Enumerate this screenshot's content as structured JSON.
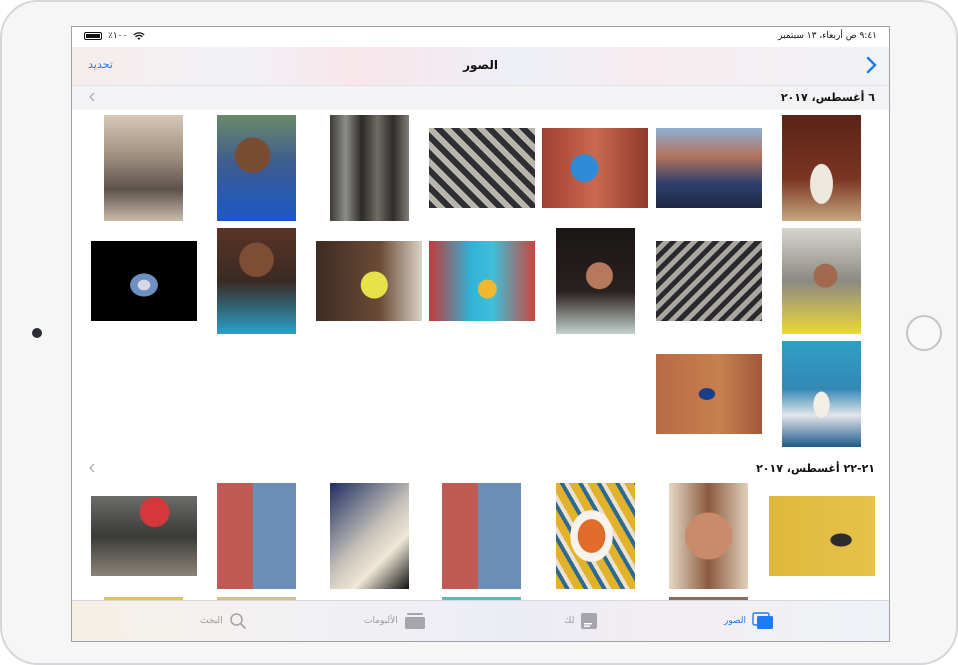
{
  "status_bar": {
    "time_date": "٩:٤١ ص  أربعاء، ١٣ سبتمبر",
    "battery": "٪١٠٠"
  },
  "nav": {
    "title": "الصور",
    "select_label": "تحديد",
    "back_icon": "chevron-right-icon"
  },
  "sections": [
    {
      "title": "٦ أغسطس، ٢٠١٧",
      "chevron_icon": "chevron-left-icon"
    },
    {
      "title": "٢١-٢٢ أغسطس، ٢٠١٧",
      "chevron_icon": "chevron-left-icon"
    }
  ],
  "tabs": [
    {
      "label": "الصور",
      "icon": "photos-icon",
      "active": true
    },
    {
      "label": "لك",
      "icon": "for-you-icon",
      "active": false
    },
    {
      "label": "الألبومات",
      "icon": "albums-icon",
      "active": false
    },
    {
      "label": "البحث",
      "icon": "search-icon",
      "active": false
    }
  ],
  "colors": {
    "accent": "#1e7cf2",
    "inactive_tab": "#9a9aa0"
  }
}
